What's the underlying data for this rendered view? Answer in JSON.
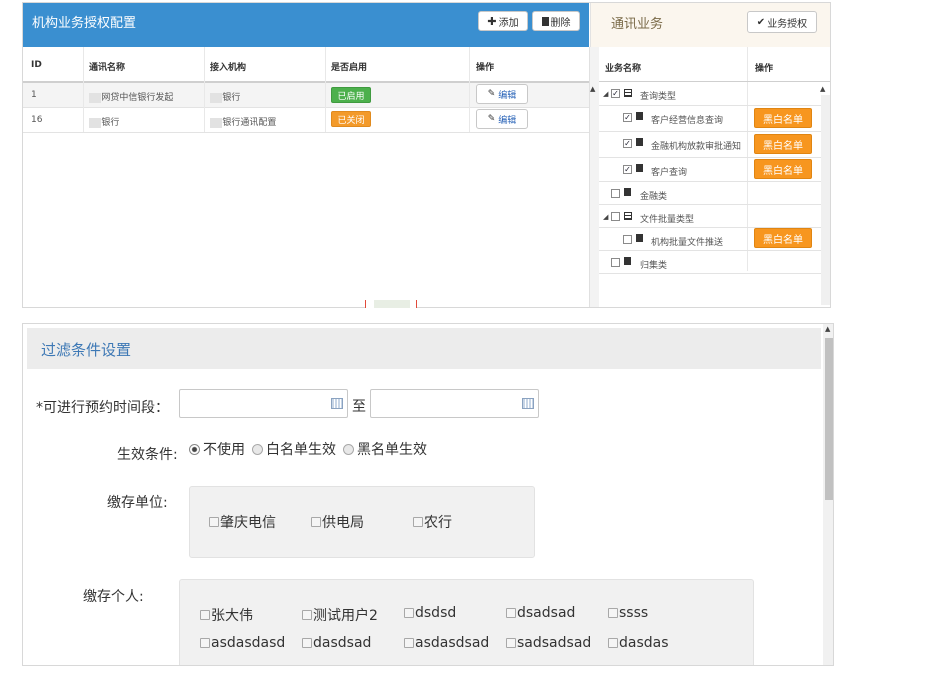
{
  "left_panel": {
    "title": "机构业务授权配置",
    "add_label": "添加",
    "delete_label": "删除",
    "columns": [
      "ID",
      "通讯名称",
      "接入机构",
      "是否启用",
      "操作"
    ],
    "rows": [
      {
        "id": "1",
        "name": "网贷中信银行发起",
        "org": "银行",
        "status": "已启用",
        "action": "编辑"
      },
      {
        "id": "16",
        "name": "银行",
        "org": "银行通讯配置",
        "status": "已关闭",
        "action": "编辑"
      }
    ]
  },
  "right_panel": {
    "title": "通讯业务",
    "auth_label": "业务授权",
    "columns": [
      "业务名称",
      "操作"
    ],
    "tree": [
      {
        "label": "查询类型",
        "checked": true,
        "bw": ""
      },
      {
        "label": "客户经营信息查询",
        "checked": true,
        "bw": "黑白名单"
      },
      {
        "label": "金融机构放款审批通知",
        "checked": true,
        "bw": "黑白名单"
      },
      {
        "label": "客户查询",
        "checked": true,
        "bw": "黑白名单"
      },
      {
        "label": "金融类",
        "checked": false,
        "bw": ""
      },
      {
        "label": "文件批量类型",
        "checked": false,
        "bw": ""
      },
      {
        "label": "机构批量文件推送",
        "checked": false,
        "bw": "黑白名单"
      },
      {
        "label": "归集类",
        "checked": false,
        "bw": ""
      }
    ]
  },
  "filter": {
    "title": "过滤条件设置",
    "time_label": "*可进行预约时间段：",
    "to_label": "至",
    "start_value": "",
    "end_value": "",
    "effect_label": "生效条件:",
    "radio_options": [
      "不使用",
      "白名单生效",
      "黑名单生效"
    ],
    "unit_label": "缴存单位:",
    "units": [
      "肇庆电信",
      "供电局",
      "农行"
    ],
    "person_label": "缴存个人:",
    "persons": [
      "张大伟",
      "测试用户2",
      "dsdsd",
      "dsadsad",
      "ssss",
      "asdasdasd",
      "dasdsad",
      "asdasdsad",
      "sadsadsad",
      "dasdas"
    ]
  }
}
